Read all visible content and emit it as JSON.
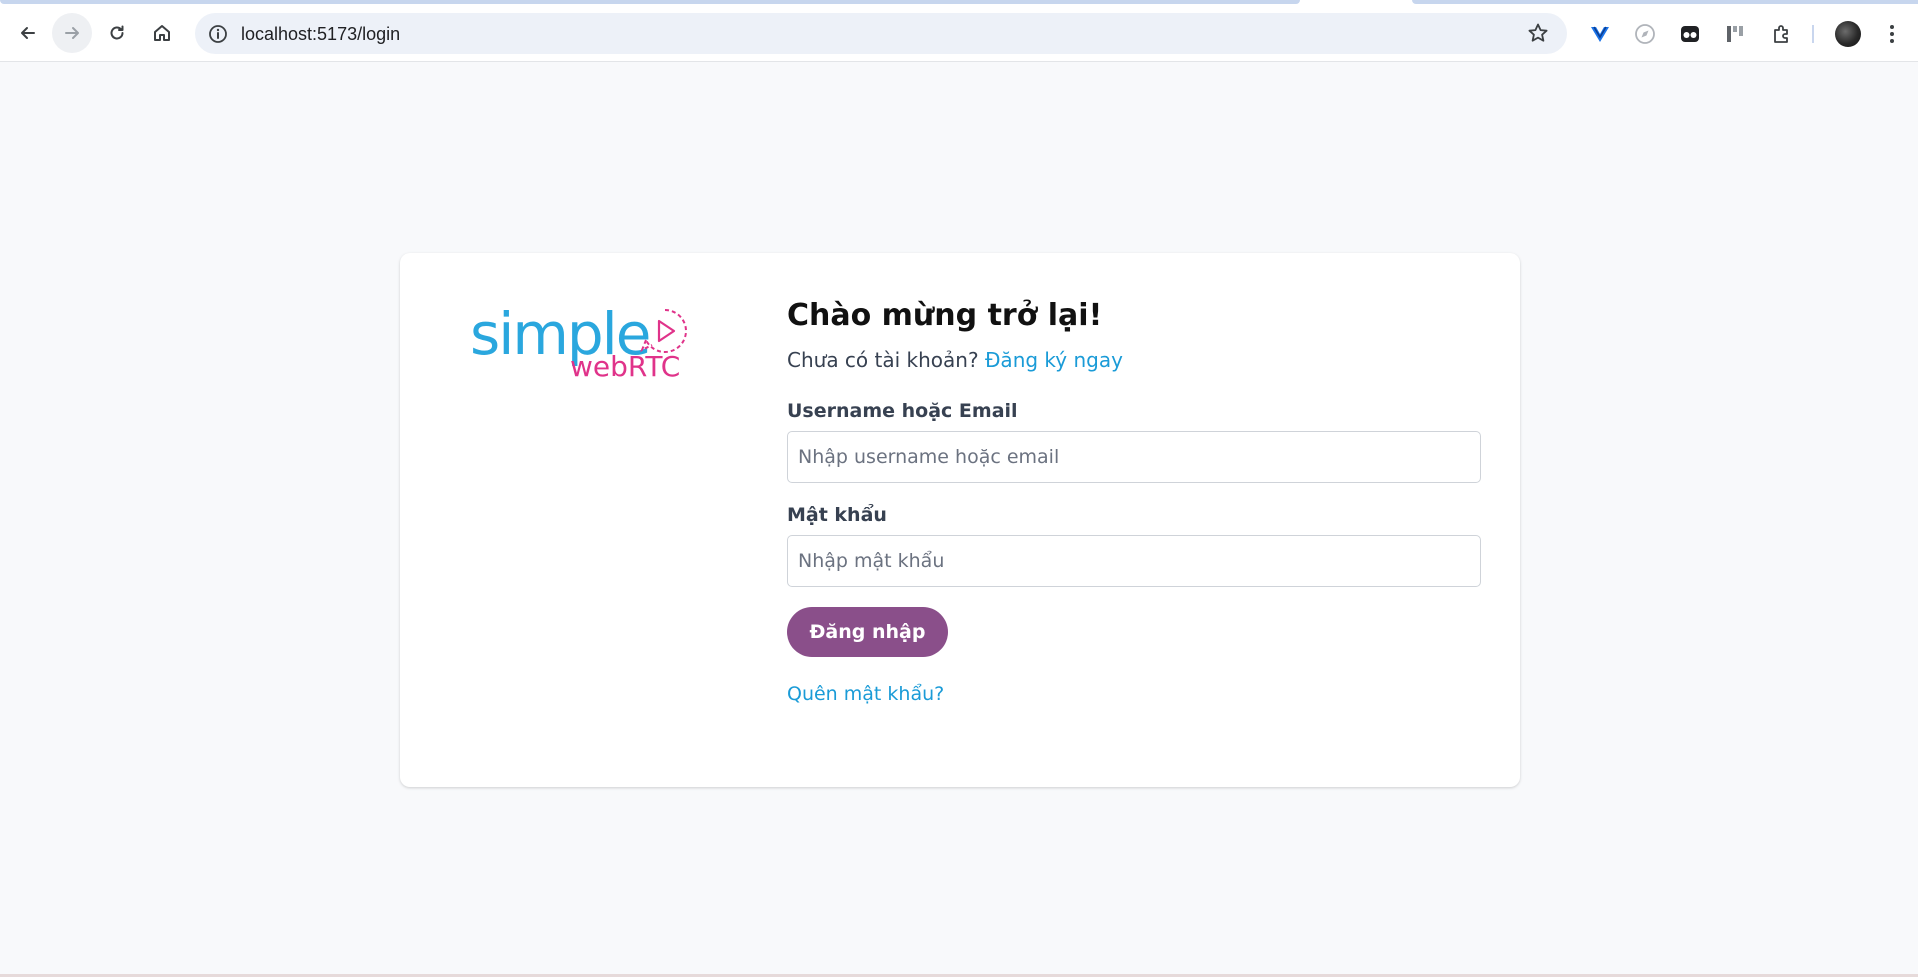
{
  "browser": {
    "url": "localhost:5173/login"
  },
  "logo": {
    "word1": "simple",
    "word2": "webRTC"
  },
  "login": {
    "title": "Chào mừng trở lại!",
    "no_account_text": "Chưa có tài khoản?",
    "register_link": "Đăng ký ngay",
    "username_label": "Username hoặc Email",
    "username_placeholder": "Nhập username hoặc email",
    "password_label": "Mật khẩu",
    "password_placeholder": "Nhập mật khẩu",
    "submit_label": "Đăng nhập",
    "forgot_link": "Quên mật khẩu?"
  },
  "colors": {
    "brand_blue": "#2aa7de",
    "brand_pink": "#e0338a",
    "button_purple": "#8a4f8a",
    "link_blue": "#1a9bd7"
  },
  "icons": [
    "back-icon",
    "forward-icon",
    "reload-icon",
    "home-icon",
    "site-info-icon",
    "bookmark-star-icon",
    "extension-icon",
    "avatar"
  ]
}
